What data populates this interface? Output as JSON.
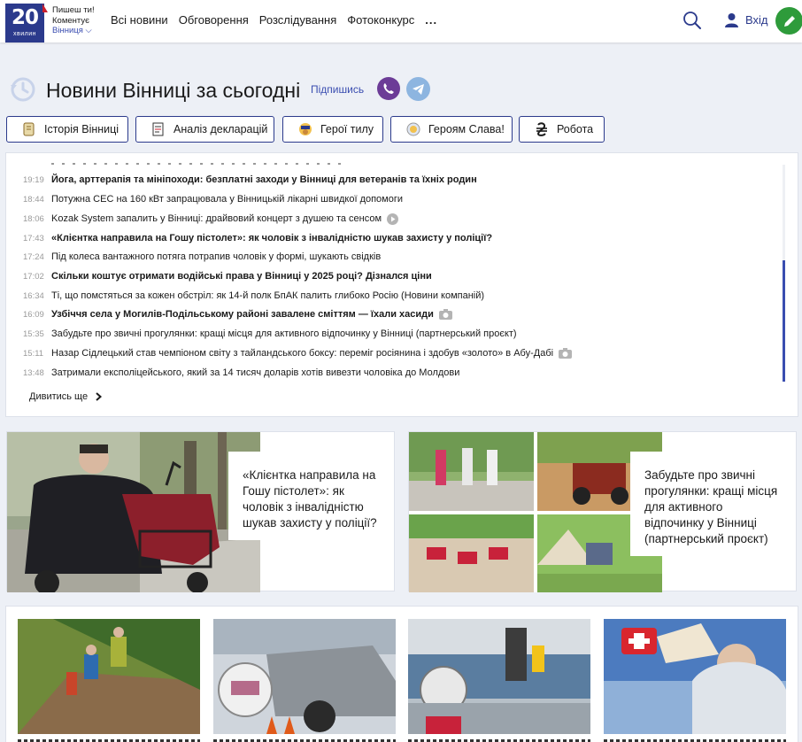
{
  "header": {
    "logo_number": "20",
    "logo_subtitle": "хвилин",
    "slogan_line1": "Пишеш ти!",
    "slogan_line2": "Коментує",
    "slogan_city": "Вінниця",
    "nav": [
      "Всі новини",
      "Обговорення",
      "Розслідування",
      "Фотоконкурс",
      "..."
    ],
    "login_label": "Вхід",
    "colors": {
      "brand": "#2b3a8c",
      "pen_button": "#2e9b3b",
      "logo_accent": "#c91f2e"
    }
  },
  "title_row": {
    "title": "Новини Вінниці за сьогодні",
    "subscribe_label": "Підпишись",
    "icons": [
      "history-icon",
      "viber-icon",
      "telegram-icon"
    ]
  },
  "tags": [
    {
      "label": "Історія Вінниці",
      "icon": "scroll-icon"
    },
    {
      "label": "Аналіз декларацій",
      "icon": "document-icon"
    },
    {
      "label": "Герої тилу",
      "icon": "hero-icon"
    },
    {
      "label": "Героям Слава!",
      "icon": "medal-icon"
    },
    {
      "label": "Робота",
      "icon": "hryvnia-icon"
    }
  ],
  "news": [
    {
      "time": "19:19",
      "text": "Йога, арттерапія та мініпоходи: безплатні заходи у Вінниці для ветеранів та їхніх родин",
      "bold": true,
      "marker": ""
    },
    {
      "time": "18:44",
      "text": "Потужна СЕС на 160 кВт запрацювала у Вінницькій лікарні швидкої допомоги",
      "bold": false,
      "marker": ""
    },
    {
      "time": "18:06",
      "text": "Kozak System запалить у Вінниці: драйвовий концерт з душею та сенсом",
      "bold": false,
      "marker": "video-icon"
    },
    {
      "time": "17:43",
      "text": "«Клієнтка направила на Гошу пістолет»: як чоловік з інвалідністю шукав захисту у поліції?",
      "bold": true,
      "marker": ""
    },
    {
      "time": "17:24",
      "text": "Під колеса вантажного потяга потрапив чоловік у формі, шукають свідків",
      "bold": false,
      "marker": ""
    },
    {
      "time": "17:02",
      "text": "Скільки коштує отримати водійські права у Вінниці у 2025 році? Дізнался ціни",
      "bold": true,
      "marker": ""
    },
    {
      "time": "16:34",
      "text": "Ті, що помстяться за кожен обстріл: як 14-й полк БпАК палить глибоко Росію (Новини компаній)",
      "bold": false,
      "marker": ""
    },
    {
      "time": "16:09",
      "text": "Узбіччя села у Могилів-Подільському районі завалене сміттям — їхали хасиди",
      "bold": true,
      "marker": "camera-icon"
    },
    {
      "time": "15:35",
      "text": "Забудьте про звичні прогулянки: кращі місця для активного відпочинку у Вінниці (партнерський проєкт)",
      "bold": false,
      "marker": ""
    },
    {
      "time": "15:11",
      "text": "Назар Сідлецький став чемпіоном світу з тайландського боксу: переміг росіянина і здобув «золото» в Абу-Дабі",
      "bold": false,
      "marker": "camera-icon"
    },
    {
      "time": "13:48",
      "text": "Затримали експоліцейського, який за 14 тисяч доларів хотів вивезти чоловіка до Молдови",
      "bold": false,
      "marker": ""
    }
  ],
  "see_more_label": "Дивитись ще",
  "features": [
    {
      "title": "«Клієнтка направила на Гошу пістолет»: як чоловік з інвалідністю шукав захисту у поліції?"
    },
    {
      "title": "Забудьте про звичні прогулянки: кращі місця для активного відпочинку у Вінниці (партнерський проєкт)"
    }
  ]
}
